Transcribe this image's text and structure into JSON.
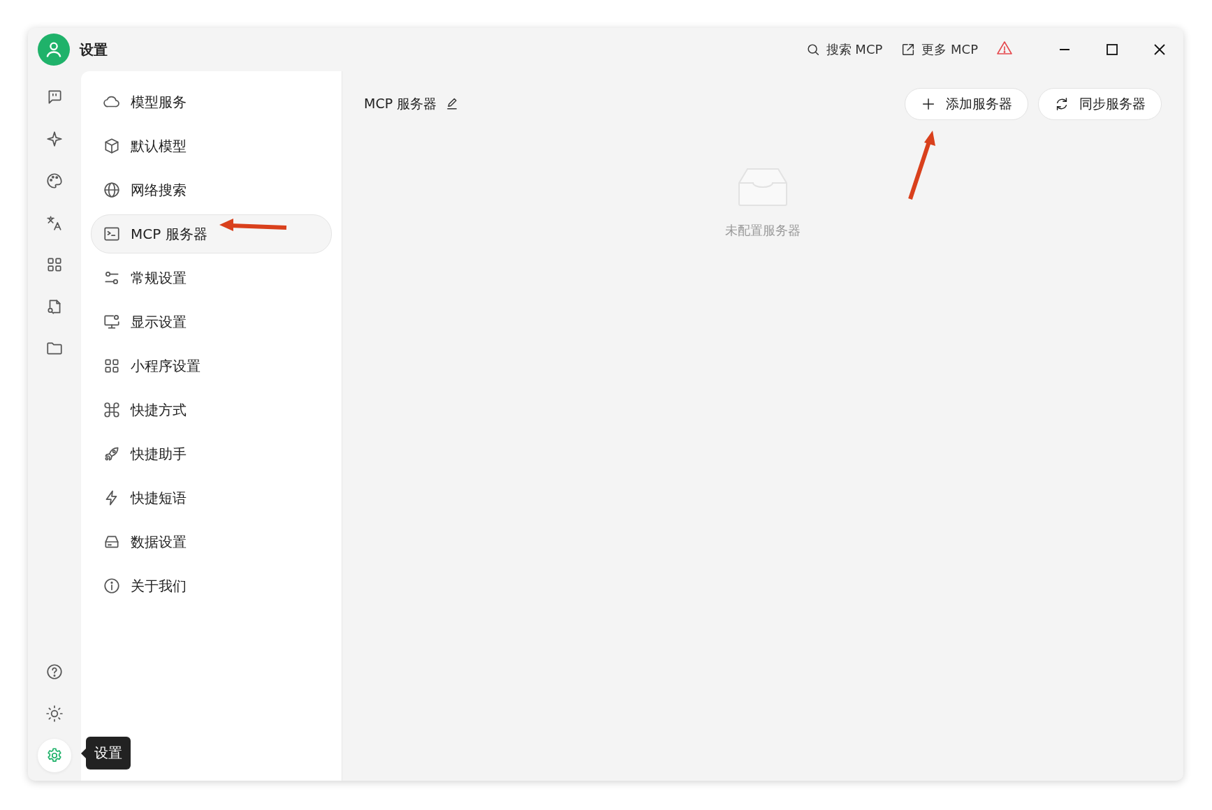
{
  "window": {
    "title": "设置"
  },
  "top_actions": [
    {
      "kind": "search",
      "label": "搜索 MCP"
    },
    {
      "kind": "external",
      "label": "更多 MCP"
    },
    {
      "kind": "warning"
    }
  ],
  "rail": {
    "items": [
      {
        "kind": "chat",
        "selected": false
      },
      {
        "kind": "sparkle",
        "selected": false
      },
      {
        "kind": "palette",
        "selected": false
      },
      {
        "kind": "translate",
        "selected": false
      },
      {
        "kind": "apps",
        "selected": false
      },
      {
        "kind": "doc-search",
        "selected": false
      },
      {
        "kind": "folder",
        "selected": false
      }
    ],
    "bottom": [
      {
        "kind": "help",
        "selected": false
      },
      {
        "kind": "sun",
        "selected": false
      },
      {
        "kind": "gear",
        "selected": true
      }
    ],
    "tooltip": "设置"
  },
  "sidebar": {
    "items": [
      {
        "kind": "cloud",
        "label": "模型服务",
        "selected": false
      },
      {
        "kind": "cube",
        "label": "默认模型",
        "selected": false
      },
      {
        "kind": "globe",
        "label": "网络搜索",
        "selected": false
      },
      {
        "kind": "terminal",
        "label": "MCP 服务器",
        "selected": true
      },
      {
        "kind": "sliders",
        "label": "常规设置",
        "selected": false
      },
      {
        "kind": "monitor",
        "label": "显示设置",
        "selected": false
      },
      {
        "kind": "apps",
        "label": "小程序设置",
        "selected": false
      },
      {
        "kind": "command",
        "label": "快捷方式",
        "selected": false
      },
      {
        "kind": "rocket",
        "label": "快捷助手",
        "selected": false
      },
      {
        "kind": "bolt",
        "label": "快捷短语",
        "selected": false
      },
      {
        "kind": "drive",
        "label": "数据设置",
        "selected": false
      },
      {
        "kind": "info",
        "label": "关于我们",
        "selected": false
      }
    ]
  },
  "main": {
    "title": "MCP 服务器",
    "buttons": [
      {
        "kind": "add",
        "label": "添加服务器"
      },
      {
        "kind": "sync",
        "label": "同步服务器"
      }
    ],
    "empty_text": "未配置服务器"
  }
}
